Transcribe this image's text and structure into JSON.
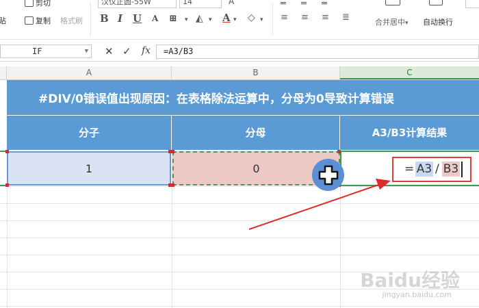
{
  "ribbon": {
    "paste_label": "贴",
    "cut_label": "剪切",
    "copy_label": "复制",
    "format_painter_label": "格式刷",
    "font_name": "汉仪正圆-55W",
    "font_size": "14",
    "merge_center_label": "合并居中",
    "wrap_text_label": "自动换行"
  },
  "formula_bar": {
    "name_box": "IF",
    "cancel_symbol": "✕",
    "confirm_symbol": "✓",
    "fx_label": "fx",
    "formula": "=A3/B3"
  },
  "columns": [
    "A",
    "B",
    "C"
  ],
  "sheet": {
    "title": "#DIV/0错误值出现原因：在表格除法运算中，分母为0导致计算错误",
    "headers": [
      "分子",
      "分母",
      "A3/B3计算结果"
    ],
    "row": {
      "a": "1",
      "b": "0"
    }
  },
  "cell_editor": {
    "equals": "=",
    "ref_a": "A3",
    "slash": "/",
    "ref_b": "B3"
  },
  "watermark": {
    "text": "Baidu经验",
    "url": "jingyan.baidu.com"
  },
  "colors": {
    "header_blue": "#5b9bd5",
    "cell_a_fill": "#dae3f3",
    "cell_b_fill": "#ecc9c4",
    "active_green": "#3aa04d",
    "annotation_red": "#e23b3b"
  }
}
